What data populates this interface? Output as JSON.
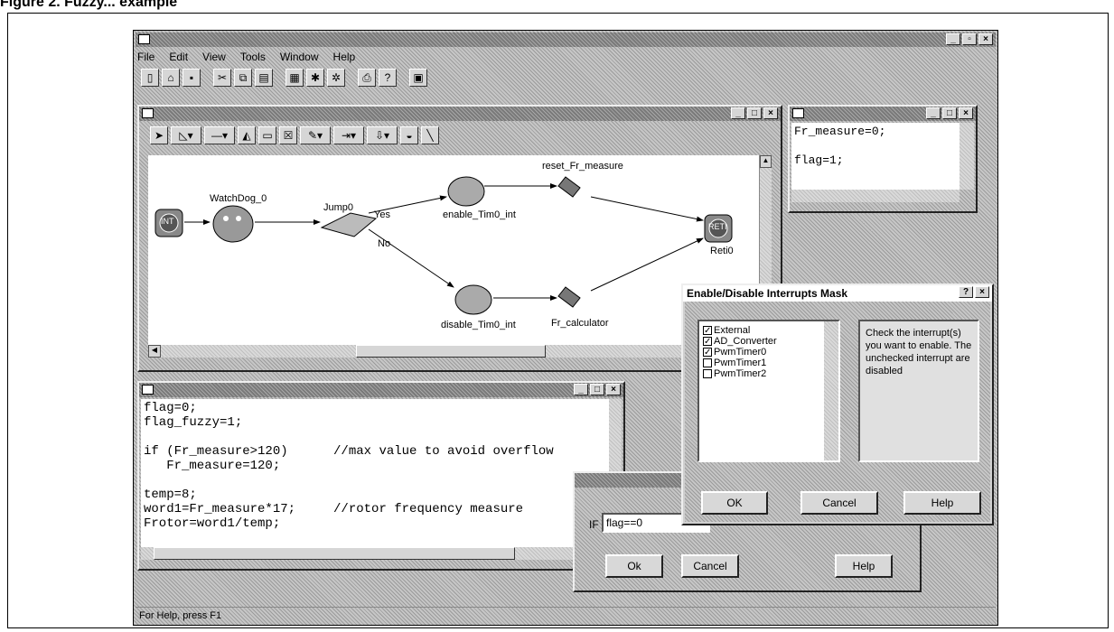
{
  "heading": "Figure 2. Fuzzy... example",
  "app": {
    "title": "",
    "menu": [
      "File",
      "Edit",
      "View",
      "Tools",
      "Window",
      "Help"
    ],
    "status": "For Help, press F1",
    "toolbar_icons": [
      "new-icon",
      "open-icon",
      "save-icon",
      "cut-icon",
      "copy-icon",
      "paste-icon",
      "grid-icon",
      "build-icon",
      "debug-icon",
      "print-icon",
      "help-icon",
      "window-icon"
    ]
  },
  "flow": {
    "title": "",
    "nodes": {
      "start": "INT",
      "watchdog": "WatchDog_0",
      "jump": "Jump0",
      "yes": "Yes",
      "no": "No",
      "enable": "enable_Tim0_int",
      "disable": "disable_Tim0_int",
      "reset": "reset_Fr_measure",
      "calc": "Fr_calculator",
      "end_icon": "RETI",
      "end": "Reti0"
    }
  },
  "reset_win": {
    "title": "",
    "code": "Fr_measure=0;\n\nflag=1;"
  },
  "calc_win": {
    "title": "",
    "code": "flag=0;\nflag_fuzzy=1;\n\nif (Fr_measure>120)      //max value to avoid overflow\n   Fr_measure=120;\n\ntemp=8;\nword1=Fr_measure*17;     //rotor frequency measure\nFrotor=word1/temp;"
  },
  "interrupts": {
    "title": "Enable/Disable Interrupts Mask",
    "help_btn": "?",
    "items": [
      {
        "label": "External",
        "checked": true
      },
      {
        "label": "AD_Converter",
        "checked": true
      },
      {
        "label": "PwmTimer0",
        "checked": true
      },
      {
        "label": "PwmTimer1",
        "checked": false
      },
      {
        "label": "PwmTimer2",
        "checked": false
      }
    ],
    "hint": "Check the interrupt(s) you want to enable. The unchecked interrupt are disabled",
    "ok": "OK",
    "cancel": "Cancel",
    "help": "Help"
  },
  "jump_dlg": {
    "title": "",
    "if_label": "IF",
    "condition": "flag==0",
    "ok": "Ok",
    "cancel": "Cancel",
    "help": "Help"
  }
}
